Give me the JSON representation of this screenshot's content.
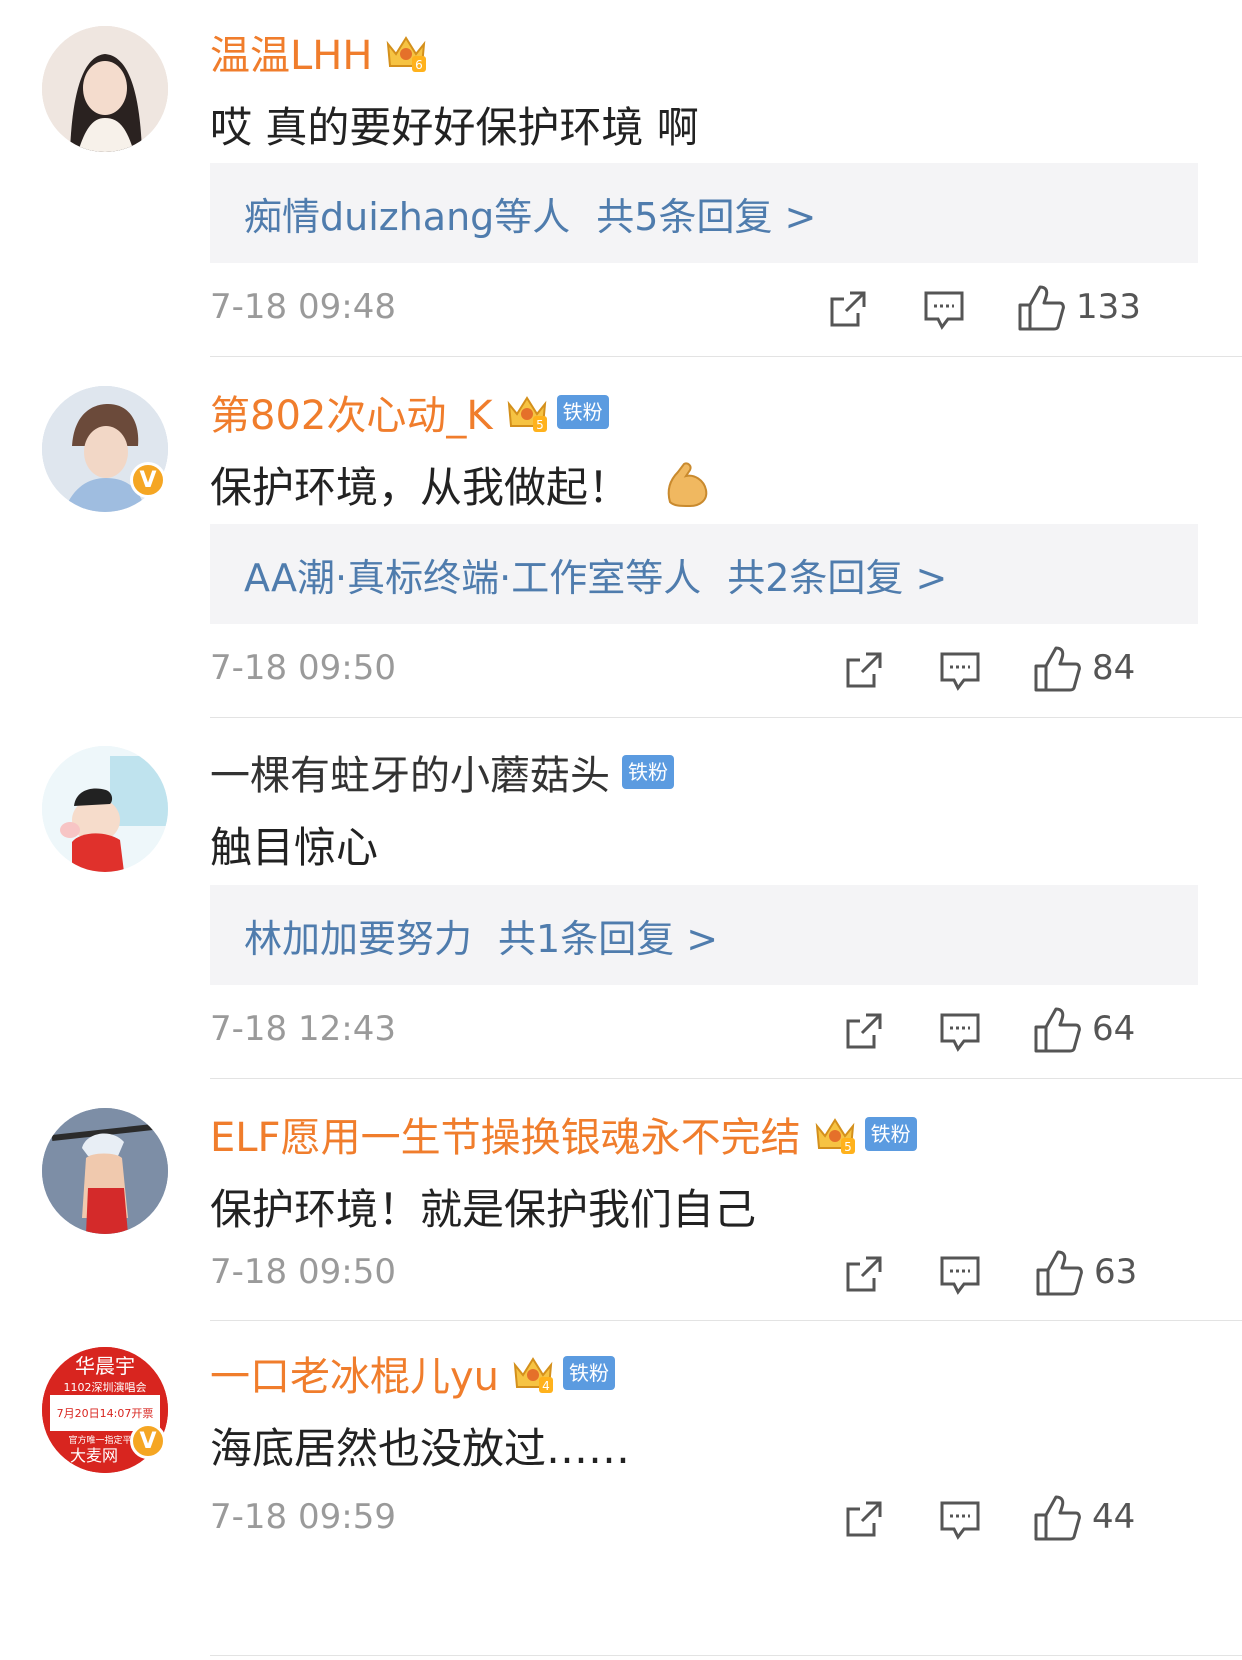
{
  "comments": [
    {
      "username": "温温LHH",
      "name_style": "orange",
      "crown": true,
      "crown_level": "6",
      "fan_badge": "",
      "verified": false,
      "text": "哎 真的要好好保护环境 啊",
      "emoji": "",
      "replies": {
        "who": "痴情duizhang等人",
        "count": "共5条回复 >"
      },
      "time": "7-18 09:48",
      "likes": "133"
    },
    {
      "username": "第802次心动_K",
      "name_style": "orange",
      "crown": true,
      "crown_level": "5",
      "fan_badge": "铁粉",
      "verified": true,
      "text": "保护环境，从我做起！",
      "emoji": "flexed-biceps-icon",
      "replies": {
        "who": "AA潮·真标终端·工作室等人",
        "count": "共2条回复 >"
      },
      "time": "7-18 09:50",
      "likes": "84"
    },
    {
      "username": "一棵有蛀牙的小蘑菇头",
      "name_style": "gray",
      "crown": false,
      "crown_level": "",
      "fan_badge": "铁粉",
      "verified": false,
      "text": "触目惊心",
      "emoji": "",
      "replies": {
        "who": "林加加要努力",
        "count": "共1条回复 >"
      },
      "time": "7-18 12:43",
      "likes": "64"
    },
    {
      "username": "ELF愿用一生节操换银魂永不完结",
      "name_style": "orange",
      "crown": true,
      "crown_level": "5",
      "fan_badge": "铁粉",
      "verified": false,
      "text": "保护环境！就是保护我们自己",
      "emoji": "",
      "replies": null,
      "time": "7-18 09:50",
      "likes": "63"
    },
    {
      "username": "一口老冰棍儿yu",
      "name_style": "orange",
      "crown": true,
      "crown_level": "4",
      "fan_badge": "铁粉",
      "verified": true,
      "text": "海底居然也没放过……",
      "emoji": "",
      "replies": null,
      "time": "7-18 09:59",
      "likes": "44",
      "avatar_text": [
        "华晨宇",
        "1102深圳演唱会",
        "7月20日14:07开票",
        "官方唯一指定平",
        "大麦网"
      ]
    }
  ],
  "colors": {
    "accent": "#f07d2c",
    "link": "#4f7cad",
    "fan_badge": "#5b9be0",
    "verified": "#f5a623"
  }
}
